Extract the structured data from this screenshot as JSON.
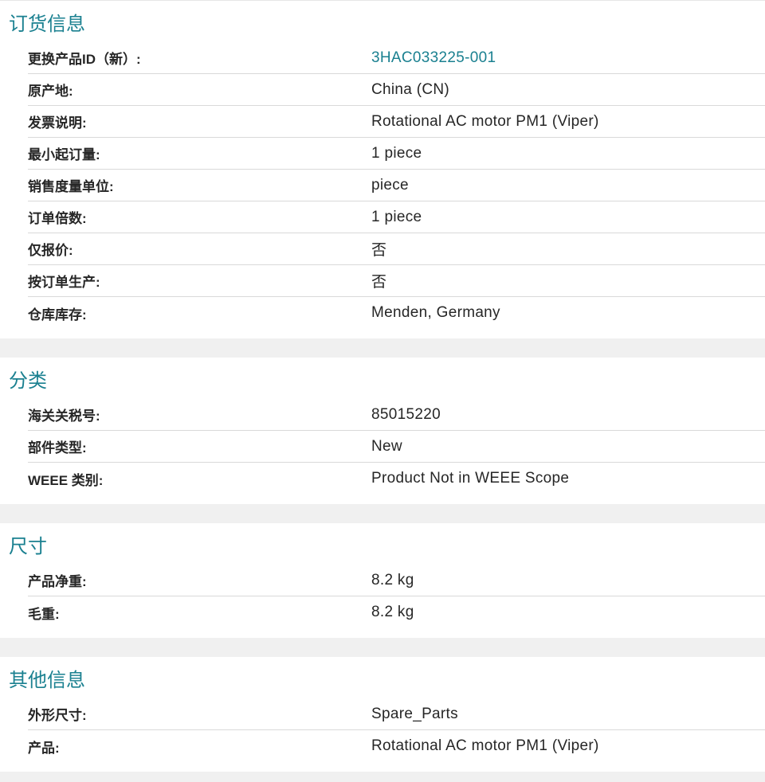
{
  "sections": [
    {
      "title": "订货信息",
      "rows": [
        {
          "label": "更换产品ID（新）:",
          "value": "3HAC033225-001"
        },
        {
          "label": "原产地:",
          "value": "China (CN)"
        },
        {
          "label": "发票说明:",
          "value": "Rotational AC motor PM1 (Viper)"
        },
        {
          "label": "最小起订量:",
          "value": "1 piece"
        },
        {
          "label": "销售度量单位:",
          "value": "piece"
        },
        {
          "label": "订单倍数:",
          "value": "1 piece"
        },
        {
          "label": "仅报价:",
          "value": "否"
        },
        {
          "label": "按订单生产:",
          "value": "否"
        },
        {
          "label": "仓库库存:",
          "value": "Menden, Germany"
        }
      ]
    },
    {
      "title": "分类",
      "rows": [
        {
          "label": "海关关税号:",
          "value": "85015220"
        },
        {
          "label": "部件类型:",
          "value": "New"
        },
        {
          "label": "WEEE 类别:",
          "value": "Product Not in WEEE Scope"
        }
      ]
    },
    {
      "title": "尺寸",
      "rows": [
        {
          "label": "产品净重:",
          "value": "8.2 kg"
        },
        {
          "label": "毛重:",
          "value": "8.2 kg"
        }
      ]
    },
    {
      "title": "其他信息",
      "rows": [
        {
          "label": "外形尺寸:",
          "value": "Spare_Parts"
        },
        {
          "label": "产品:",
          "value": "Rotational AC motor PM1 (Viper)"
        }
      ]
    }
  ],
  "colors": {
    "accent": "#1a8090",
    "background": "#f0f0f0",
    "panel": "#ffffff",
    "divider": "#d9d9d9"
  }
}
